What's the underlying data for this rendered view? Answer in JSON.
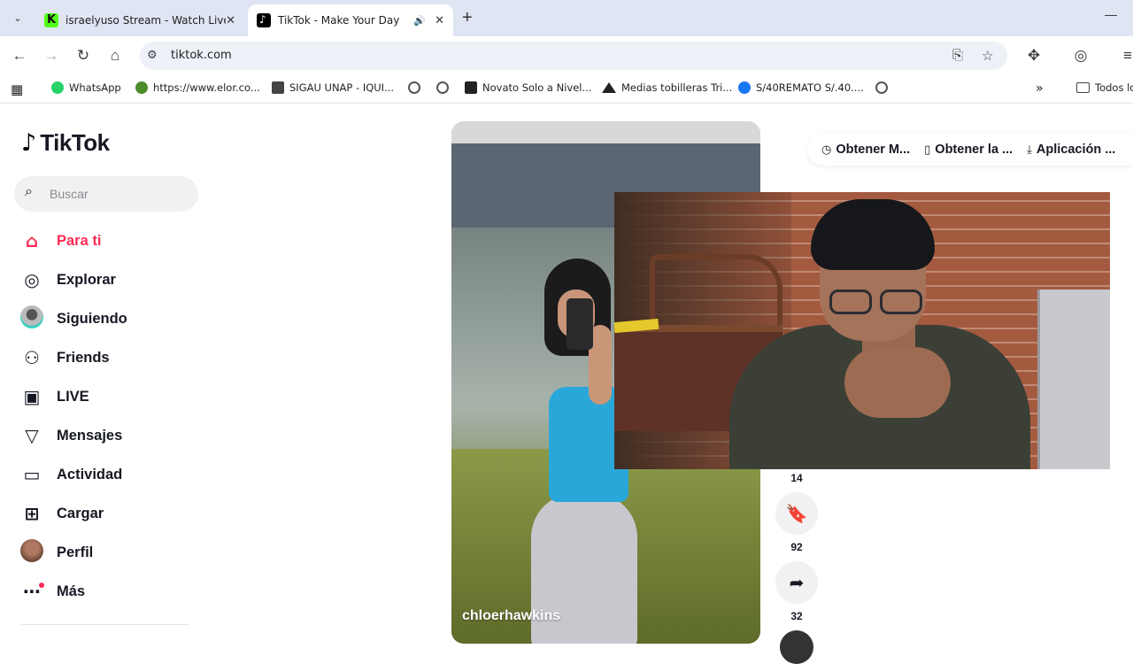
{
  "browser": {
    "tabs": [
      {
        "title": "israelyuso Stream - Watch Live",
        "favicon": "kick-icon",
        "active": false
      },
      {
        "title": "TikTok - Make Your Day",
        "favicon": "tiktok-icon",
        "active": true,
        "audio": true
      }
    ],
    "url": "tiktok.com",
    "bookmarks": [
      {
        "label": "WhatsApp",
        "icon": "whatsapp-icon"
      },
      {
        "label": "https://www.elor.co...",
        "icon": "elor-icon"
      },
      {
        "label": "SIGAU UNAP - IQUI...",
        "icon": "sigau-icon"
      },
      {
        "label": "",
        "icon": "globe-icon"
      },
      {
        "label": "",
        "icon": "globe-icon"
      },
      {
        "label": "Novato Solo a Nivel...",
        "icon": "mw-icon"
      },
      {
        "label": "Medias tobilleras Tri...",
        "icon": "mountain-icon"
      },
      {
        "label": "S/40REMATO S/.40....",
        "icon": "facebook-icon"
      },
      {
        "label": "",
        "icon": "globe-icon"
      }
    ],
    "overflow_chevron": "»",
    "all_bookmarks_label": "Todos lo"
  },
  "tiktok": {
    "logo_text": "TikTok",
    "search_placeholder": "Buscar",
    "nav": [
      {
        "label": "Para ti",
        "icon": "home-icon",
        "active": true
      },
      {
        "label": "Explorar",
        "icon": "compass-icon"
      },
      {
        "label": "Siguiendo",
        "icon": "following-avatar"
      },
      {
        "label": "Friends",
        "icon": "friends-icon"
      },
      {
        "label": "LIVE",
        "icon": "live-tv-icon"
      },
      {
        "label": "Mensajes",
        "icon": "send-icon"
      },
      {
        "label": "Actividad",
        "icon": "activity-icon"
      },
      {
        "label": "Cargar",
        "icon": "upload-icon"
      },
      {
        "label": "Perfil",
        "icon": "profile-avatar"
      },
      {
        "label": "Más",
        "icon": "more-icon"
      }
    ],
    "get_app": [
      {
        "label": "Obtener M...",
        "icon": "tiktok-coin-icon"
      },
      {
        "label": "Obtener la ...",
        "icon": "phone-icon"
      },
      {
        "label": "Aplicación ...",
        "icon": "download-icon"
      }
    ],
    "video": {
      "username": "chloerhawkins"
    },
    "actions": {
      "comments": "14",
      "saves": "92",
      "shares": "32"
    },
    "accent_color": "#fe2c55"
  }
}
